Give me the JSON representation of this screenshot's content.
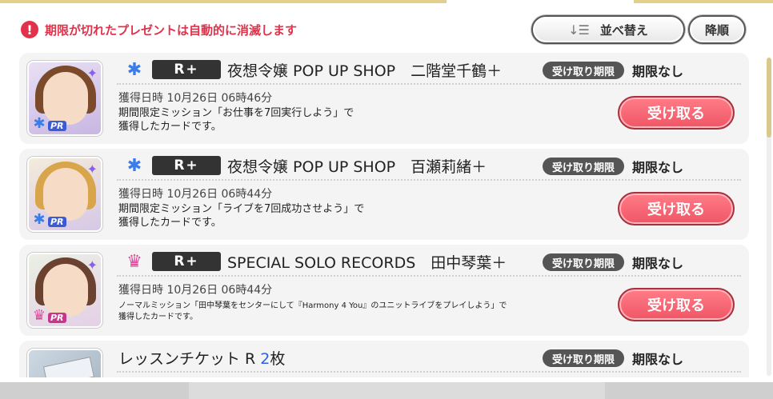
{
  "notice": {
    "icon": "exclamation-icon",
    "icon_glyph": "!",
    "text": "期限が切れたプレゼントは自動的に消滅します"
  },
  "toolbar": {
    "sort_icon": "↓☰",
    "sort_label": "並べ替え",
    "order_label": "降順"
  },
  "colors": {
    "accent_gold": "#e2cf8c",
    "notice_red": "#e2314a",
    "receive_button": "#f05566",
    "quantity_blue": "#2f5ee0"
  },
  "items": [
    {
      "attribute_icon": "✱",
      "attribute_color": "#3b7de8",
      "rarity": "R+",
      "title": "夜想令嬢 POP UP SHOP　二階堂千鶴＋",
      "expire_label": "受け取り期限",
      "expire_value": "期限なし",
      "date": "獲得日時 10月26日 06時46分",
      "desc_line1": "期間限定ミッション「お仕事を7回実行しよう」で",
      "desc_line2": "獲得したカードです。",
      "button": "受け取る",
      "thumb_badge": "PR"
    },
    {
      "attribute_icon": "✱",
      "attribute_color": "#3b7de8",
      "rarity": "R+",
      "title": "夜想令嬢 POP UP SHOP　百瀬莉緒＋",
      "expire_label": "受け取り期限",
      "expire_value": "期限なし",
      "date": "獲得日時 10月26日 06時44分",
      "desc_line1": "期間限定ミッション「ライブを7回成功させよう」で",
      "desc_line2": "獲得したカードです。",
      "button": "受け取る",
      "thumb_badge": "PR"
    },
    {
      "attribute_icon": "♛",
      "attribute_color": "#e0479a",
      "rarity": "R+",
      "title": "SPECIAL SOLO RECORDS　田中琴葉＋",
      "expire_label": "受け取り期限",
      "expire_value": "期限なし",
      "date": "獲得日時 10月26日 06時44分",
      "desc_line1": "ノーマルミッション「田中琴葉をセンターにして『Harmony 4 You』のユニットライブをプレイしよう」で",
      "desc_line2": "獲得したカードです。",
      "button": "受け取る",
      "thumb_badge": "PR"
    },
    {
      "title": "レッスンチケット R ",
      "quantity": "2",
      "quantity_unit": "枚",
      "expire_label": "受け取り期限",
      "expire_value": "期限なし"
    }
  ]
}
